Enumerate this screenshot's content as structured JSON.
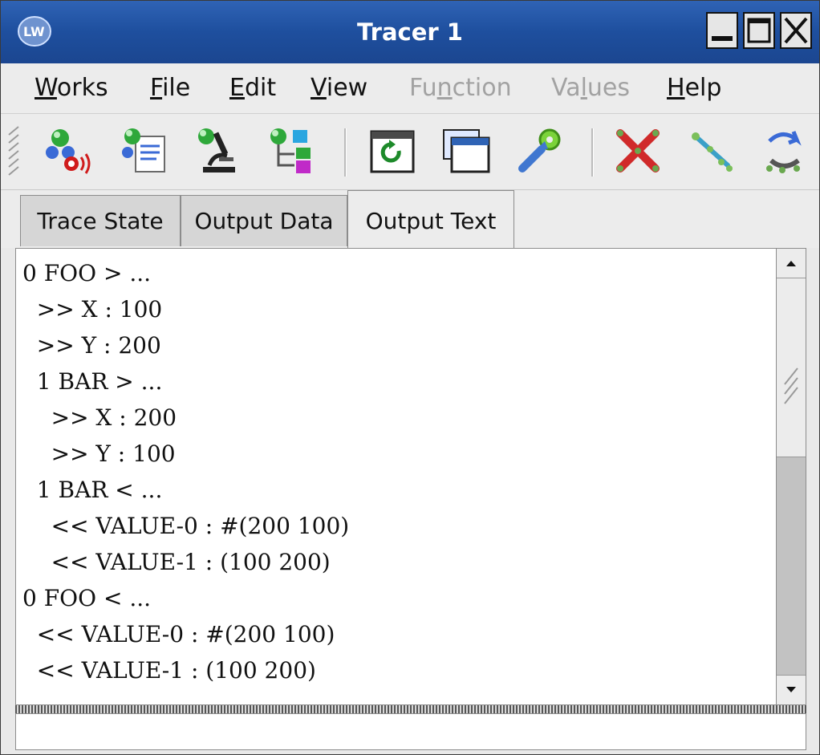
{
  "window": {
    "title": "Tracer 1"
  },
  "menu": [
    {
      "label": "Works",
      "disabled": false
    },
    {
      "label": "File",
      "disabled": false
    },
    {
      "label": "Edit",
      "disabled": false
    },
    {
      "label": "View",
      "disabled": false
    },
    {
      "label": "Function",
      "disabled": true
    },
    {
      "label": "Values",
      "disabled": true
    },
    {
      "label": "Help",
      "disabled": false
    }
  ],
  "toolbar": {
    "icons": [
      "trace-network-icon",
      "trace-document-icon",
      "inspect-microscope-icon",
      "trace-tree-icon",
      "refresh-window-icon",
      "window-icon",
      "settings-wrench-icon",
      "untrace-all-icon",
      "untrace-icon",
      "restore-icon"
    ]
  },
  "tabs": [
    {
      "label": "Trace State",
      "active": false
    },
    {
      "label": "Output Data",
      "active": false
    },
    {
      "label": "Output Text",
      "active": true
    }
  ],
  "output": {
    "text": "0 FOO > ...\n  >> X : 100\n  >> Y : 200\n  1 BAR > ...\n    >> X : 200\n    >> Y : 100\n  1 BAR < ...\n    << VALUE-0 : #(200 100)\n    << VALUE-1 : (100 200)\n0 FOO < ...\n  << VALUE-0 : #(200 100)\n  << VALUE-1 : (100 200)"
  },
  "status": {
    "text": ""
  },
  "colors": {
    "titlebar": "#1e4f9e",
    "chrome": "#ececec",
    "disabled_text": "#a2a2a2"
  }
}
